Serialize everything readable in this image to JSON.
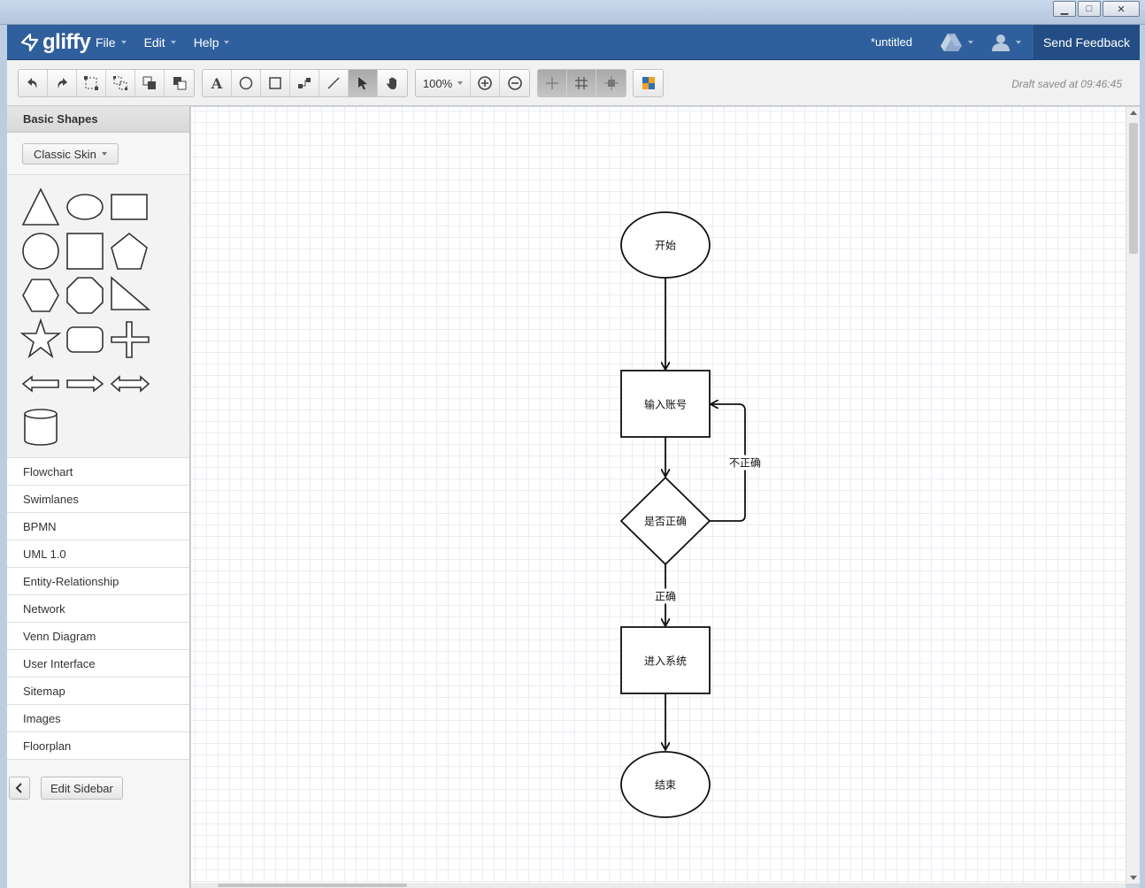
{
  "window": {
    "minimize": "▁",
    "maximize": "□",
    "close": "✕"
  },
  "app": {
    "logo_text": "gliffy",
    "menus": [
      {
        "label": "File"
      },
      {
        "label": "Edit"
      },
      {
        "label": "Help"
      }
    ],
    "doc_title": "*untitled",
    "send_feedback": "Send Feedback"
  },
  "toolbar": {
    "zoom": "100%",
    "draft_status": "Draft saved at 09:46:45",
    "text_tool": "A"
  },
  "sidebar": {
    "header": "Basic Shapes",
    "skin_label": "Classic Skin",
    "libraries": [
      {
        "label": "Flowchart"
      },
      {
        "label": "Swimlanes"
      },
      {
        "label": "BPMN"
      },
      {
        "label": "UML 1.0"
      },
      {
        "label": "Entity-Relationship"
      },
      {
        "label": "Network"
      },
      {
        "label": "Venn Diagram"
      },
      {
        "label": "User Interface"
      },
      {
        "label": "Sitemap"
      },
      {
        "label": "Images"
      },
      {
        "label": "Floorplan"
      }
    ],
    "edit_sidebar": "Edit Sidebar"
  },
  "diagram": {
    "start": "开始",
    "input": "输入账号",
    "decision": "是否正确",
    "edge_incorrect": "不正确",
    "edge_correct": "正确",
    "enter": "进入系统",
    "end": "结束"
  },
  "colors": {
    "header_blue": "#2f5f9d",
    "feedback_blue": "#234d84"
  }
}
